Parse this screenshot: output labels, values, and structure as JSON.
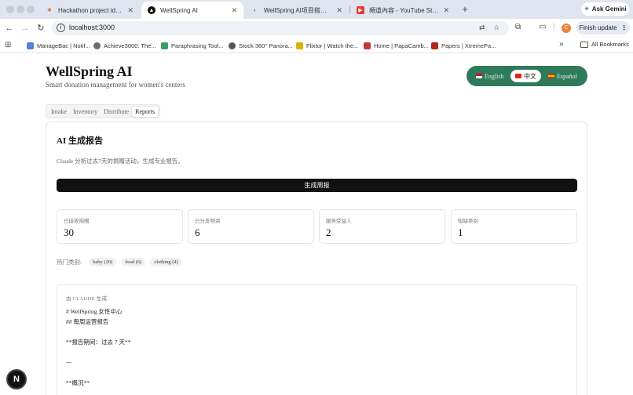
{
  "browser": {
    "tabs": [
      {
        "title": "Hackathon project ideas for a",
        "active": false,
        "favicon": "sparkle-favicon"
      },
      {
        "title": "WellSpring AI",
        "active": true,
        "favicon": "triangle-favicon"
      },
      {
        "title": "WellSpring AI项目搭建指南语",
        "active": false,
        "favicon": "claude-favicon"
      },
      {
        "title": "頻道內容 - YouTube Studio",
        "active": false,
        "favicon": "youtube-favicon"
      }
    ],
    "gemini_label": "Ask Gemini",
    "url": "localhost:3000",
    "finish_update": "Finish update",
    "profile_initial": "C",
    "bookmarks": [
      {
        "label": "ManageBac | Notif...",
        "color": "#5b7fd6"
      },
      {
        "label": "Achieve3000: The...",
        "color": "#6b6b6b"
      },
      {
        "label": "Paraphrasing Tool...",
        "color": "#3aa15a"
      },
      {
        "label": "Stock 360° Panora...",
        "color": "#555555"
      },
      {
        "label": "Flixtor | Watch the...",
        "color": "#d8b400"
      },
      {
        "label": "Home | PapaCamb...",
        "color": "#c23a3a"
      },
      {
        "label": "Papers | XtremePa...",
        "color": "#b3261e"
      }
    ],
    "all_bookmarks": "All Bookmarks"
  },
  "app": {
    "title": "WellSpring AI",
    "subtitle": "Smart donation management for women's centers",
    "languages": [
      {
        "label": "English",
        "selected": false
      },
      {
        "label": "中文",
        "selected": true
      },
      {
        "label": "Español",
        "selected": false
      }
    ],
    "tabs": [
      "Intake",
      "Inventory",
      "Distribute",
      "Reports"
    ],
    "active_tab": "Reports",
    "accent_color": "#2f7a5b"
  },
  "report": {
    "title": "AI 生成报告",
    "description": "Claude 分析过去7天的捐赠活动，生成专业报告。",
    "generate_button": "生成周报",
    "stats": [
      {
        "label": "已接收捐赠",
        "value": "30"
      },
      {
        "label": "已分发物资",
        "value": "6"
      },
      {
        "label": "服务受益人",
        "value": "2"
      },
      {
        "label": "短缺类别",
        "value": "1"
      }
    ],
    "hot_label": "热门类别:",
    "hot_categories": [
      "baby (20)",
      "food (6)",
      "clothing (4)"
    ],
    "generated_by": "由 CLAUDE 生成",
    "content_lines": [
      "# WellSpring 女性中心",
      "## 每周运营报告",
      "",
      "**报告期间：过去 7 天**",
      "",
      "---",
      "",
      "**概况**"
    ]
  },
  "overlay": {
    "n_badge": "N"
  }
}
